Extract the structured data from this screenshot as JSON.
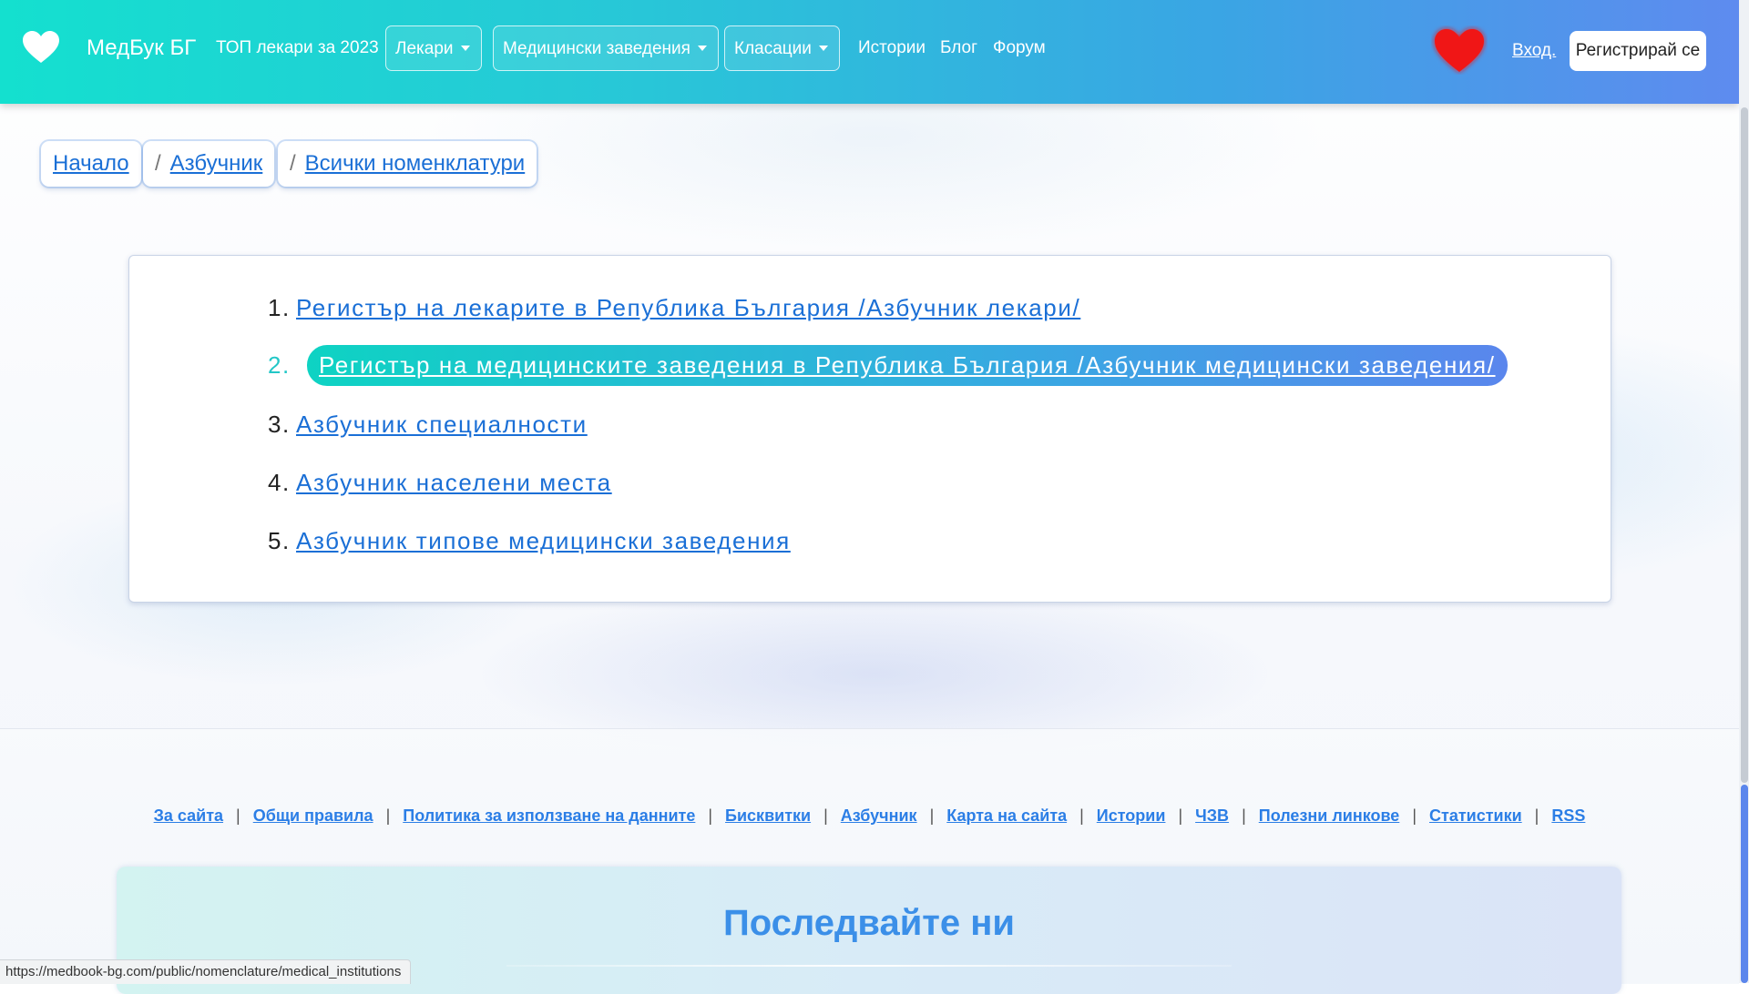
{
  "navbar": {
    "brand": "МедБук БГ",
    "top_link": "ТОП лекари за 2023",
    "dropdowns": [
      "Лекари",
      "Медицински заведения",
      "Класации"
    ],
    "links": [
      "Истории",
      "Блог",
      "Форум"
    ],
    "login": "Вход.",
    "register": "Регистрирай се"
  },
  "breadcrumb": [
    "Начало",
    "Азбучник",
    "Всички номенклатури"
  ],
  "breadcrumb_separator": "/",
  "nomenclatures": [
    {
      "num": "1.",
      "label": "Регистър на лекарите в Република България /Азбучник лекари/"
    },
    {
      "num": "2.",
      "label": "Регистър на медицинските заведения в Република България /Азбучник медицински заведения/"
    },
    {
      "num": "3.",
      "label": "Азбучник специалности"
    },
    {
      "num": "4.",
      "label": "Азбучник населени места"
    },
    {
      "num": "5.",
      "label": "Азбучник типове медицински заведения"
    }
  ],
  "footer": {
    "links": [
      "За сайта",
      "Общи правила",
      "Политика за използване на данните",
      "Бисквитки",
      "Азбучник",
      "Карта на сайта",
      "Истории",
      "ЧЗВ",
      "Полезни линкове",
      "Статистики",
      "RSS"
    ],
    "separator": "|",
    "follow_title": "Последвайте ни"
  },
  "status_url": "https://medbook-bg.com/public/nomenclature/medical_institutions",
  "colors": {
    "nav_gradient_start": "#14e0cf",
    "nav_gradient_end": "#5e8bef",
    "link": "#1a6fd6",
    "heart": "#f01414",
    "active_number": "#22c7c7",
    "follow_title": "#3b8fe8"
  },
  "icons": {
    "logo": "heart-logo-icon",
    "favorites": "heart-icon",
    "caret": "caret-down-icon"
  }
}
